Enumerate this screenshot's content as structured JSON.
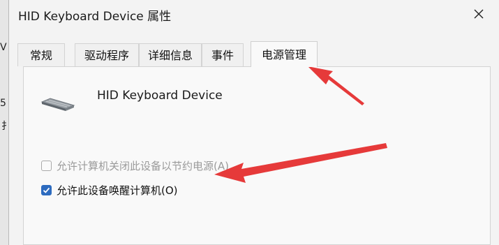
{
  "background": {
    "fragment_1": "V",
    "fragment_2": "5",
    "fragment_3": "扌"
  },
  "window": {
    "title": "HID Keyboard Device 属性",
    "close_symbol": "✕"
  },
  "tabs": [
    {
      "label": "常规",
      "active": false
    },
    {
      "label": "驱动程序",
      "active": false
    },
    {
      "label": "详细信息",
      "active": false
    },
    {
      "label": "事件",
      "active": false
    },
    {
      "label": "电源管理",
      "active": true
    }
  ],
  "device": {
    "name": "HID Keyboard Device",
    "icon": "keyboard-icon"
  },
  "options": [
    {
      "label": "允许计算机关闭此设备以节约电源(A)",
      "checked": false,
      "enabled": false
    },
    {
      "label": "允许此设备唤醒计算机(O)",
      "checked": true,
      "enabled": true
    }
  ],
  "colors": {
    "annotation_arrow": "#e63a3a",
    "checkbox_accent": "#2d6bbf"
  }
}
